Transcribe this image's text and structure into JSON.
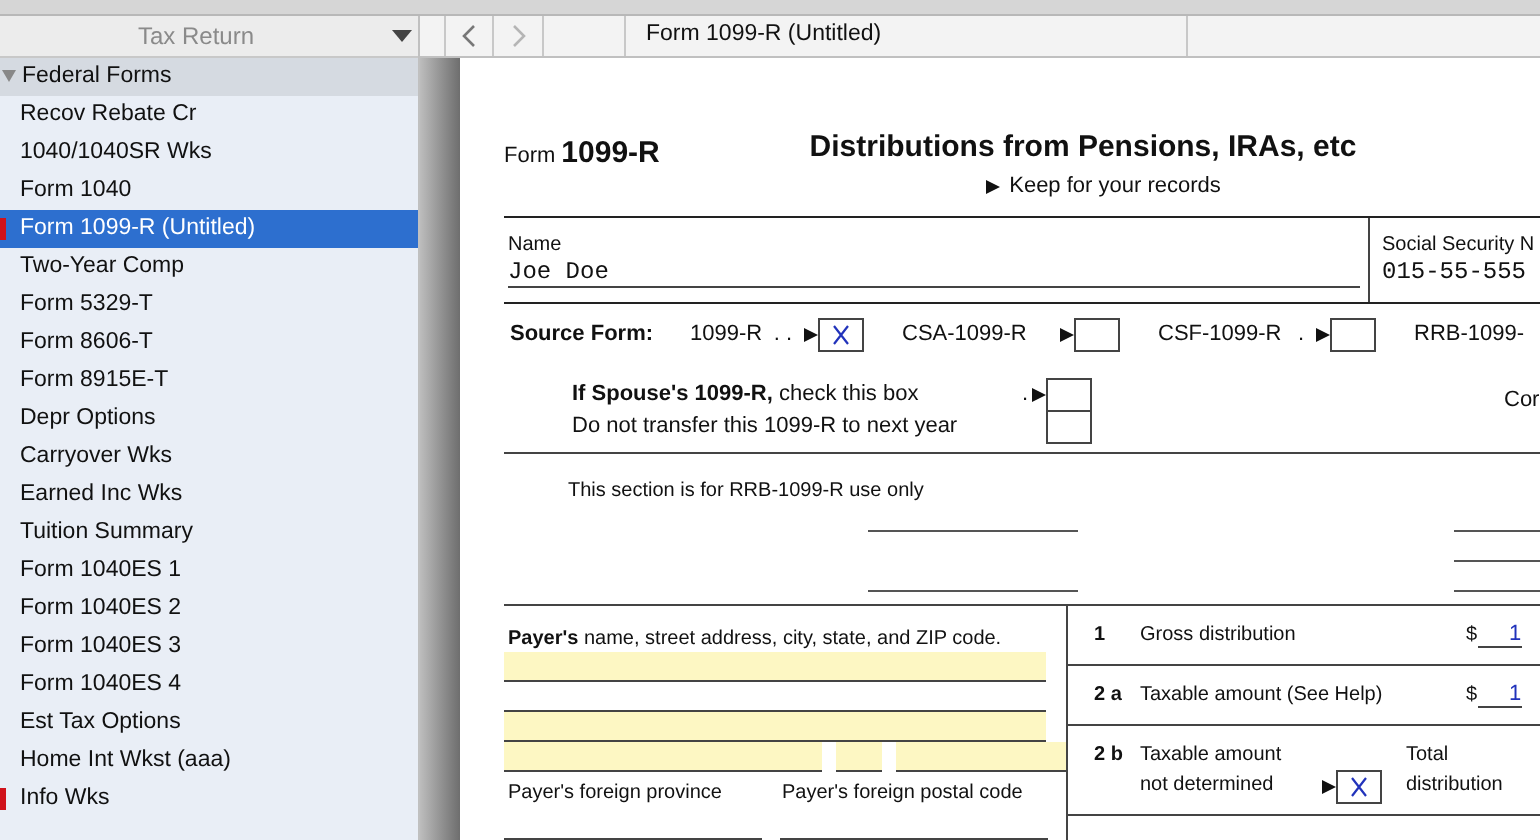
{
  "sidebar": {
    "header": "Tax Return",
    "sections": [
      {
        "label": "Federal Forms",
        "expanded": true,
        "items": [
          {
            "label": "Recov Rebate Cr",
            "selected": false,
            "flagged": false
          },
          {
            "label": "1040/1040SR Wks",
            "selected": false,
            "flagged": false
          },
          {
            "label": "Form 1040",
            "selected": false,
            "flagged": false
          },
          {
            "label": "Form 1099-R (Untitled)",
            "selected": true,
            "flagged": true
          },
          {
            "label": "Two-Year Comp",
            "selected": false,
            "flagged": false
          },
          {
            "label": "Form 5329-T",
            "selected": false,
            "flagged": false
          },
          {
            "label": "Form 8606-T",
            "selected": false,
            "flagged": false
          },
          {
            "label": "Form 8915E-T",
            "selected": false,
            "flagged": false
          },
          {
            "label": "Depr Options",
            "selected": false,
            "flagged": false
          },
          {
            "label": "Carryover Wks",
            "selected": false,
            "flagged": false
          },
          {
            "label": "Earned Inc Wks",
            "selected": false,
            "flagged": false
          },
          {
            "label": "Tuition Summary",
            "selected": false,
            "flagged": false
          },
          {
            "label": "Form 1040ES 1",
            "selected": false,
            "flagged": false
          },
          {
            "label": "Form 1040ES 2",
            "selected": false,
            "flagged": false
          },
          {
            "label": "Form 1040ES 3",
            "selected": false,
            "flagged": false
          },
          {
            "label": "Form 1040ES 4",
            "selected": false,
            "flagged": false
          },
          {
            "label": "Est Tax Options",
            "selected": false,
            "flagged": false
          },
          {
            "label": "Home Int Wkst (aaa)",
            "selected": false,
            "flagged": false
          },
          {
            "label": "Info Wks",
            "selected": false,
            "flagged": true
          }
        ]
      }
    ]
  },
  "nav": {
    "tab": "Form 1099-R (Untitled)"
  },
  "form": {
    "form_word": "Form",
    "form_number": "1099-R",
    "title": "Distributions from Pensions, IRAs, etc",
    "subtitle": "Keep for your records",
    "name_label": "Name",
    "name_value": "Joe Doe",
    "ssn_label": "Social Security N",
    "ssn_value": "015-55-555",
    "source_label": "Source Form:",
    "source_options": [
      {
        "label": "1099-R",
        "leader": ". .",
        "checked": true
      },
      {
        "label": "CSA-1099-R",
        "checked": false
      },
      {
        "label": "CSF-1099-R",
        "leader": ".",
        "checked": false
      },
      {
        "label": "RRB-1099-"
      }
    ],
    "spouse": {
      "text": "**If Spouse's 1099-R,** check this box",
      "leader": ".",
      "checked": false
    },
    "no_transfer": {
      "text": "Do not transfer this 1099-R to next year",
      "checked": false
    },
    "right_cut": "Cor",
    "rrb_note": "This section is for RRB-1099-R use only",
    "payer_label": "**Payer's** name, street address, city, state, and ZIP code.",
    "payer_foreign_province": "Payer's foreign province",
    "payer_foreign_postal": "Payer's foreign postal code",
    "boxes": [
      {
        "kind": "amount",
        "number": "1",
        "label": "Gross distribution",
        "currency": "$",
        "value": "1"
      },
      {
        "kind": "amount",
        "number": "2 a",
        "label": "Taxable amount (See Help)",
        "currency": "$",
        "value": "1"
      },
      {
        "kind": "check",
        "number": "2 b",
        "label_lines": [
          "Taxable amount",
          "not determined"
        ],
        "checked": true,
        "side_lines": [
          "Total",
          "distribution"
        ]
      }
    ]
  }
}
